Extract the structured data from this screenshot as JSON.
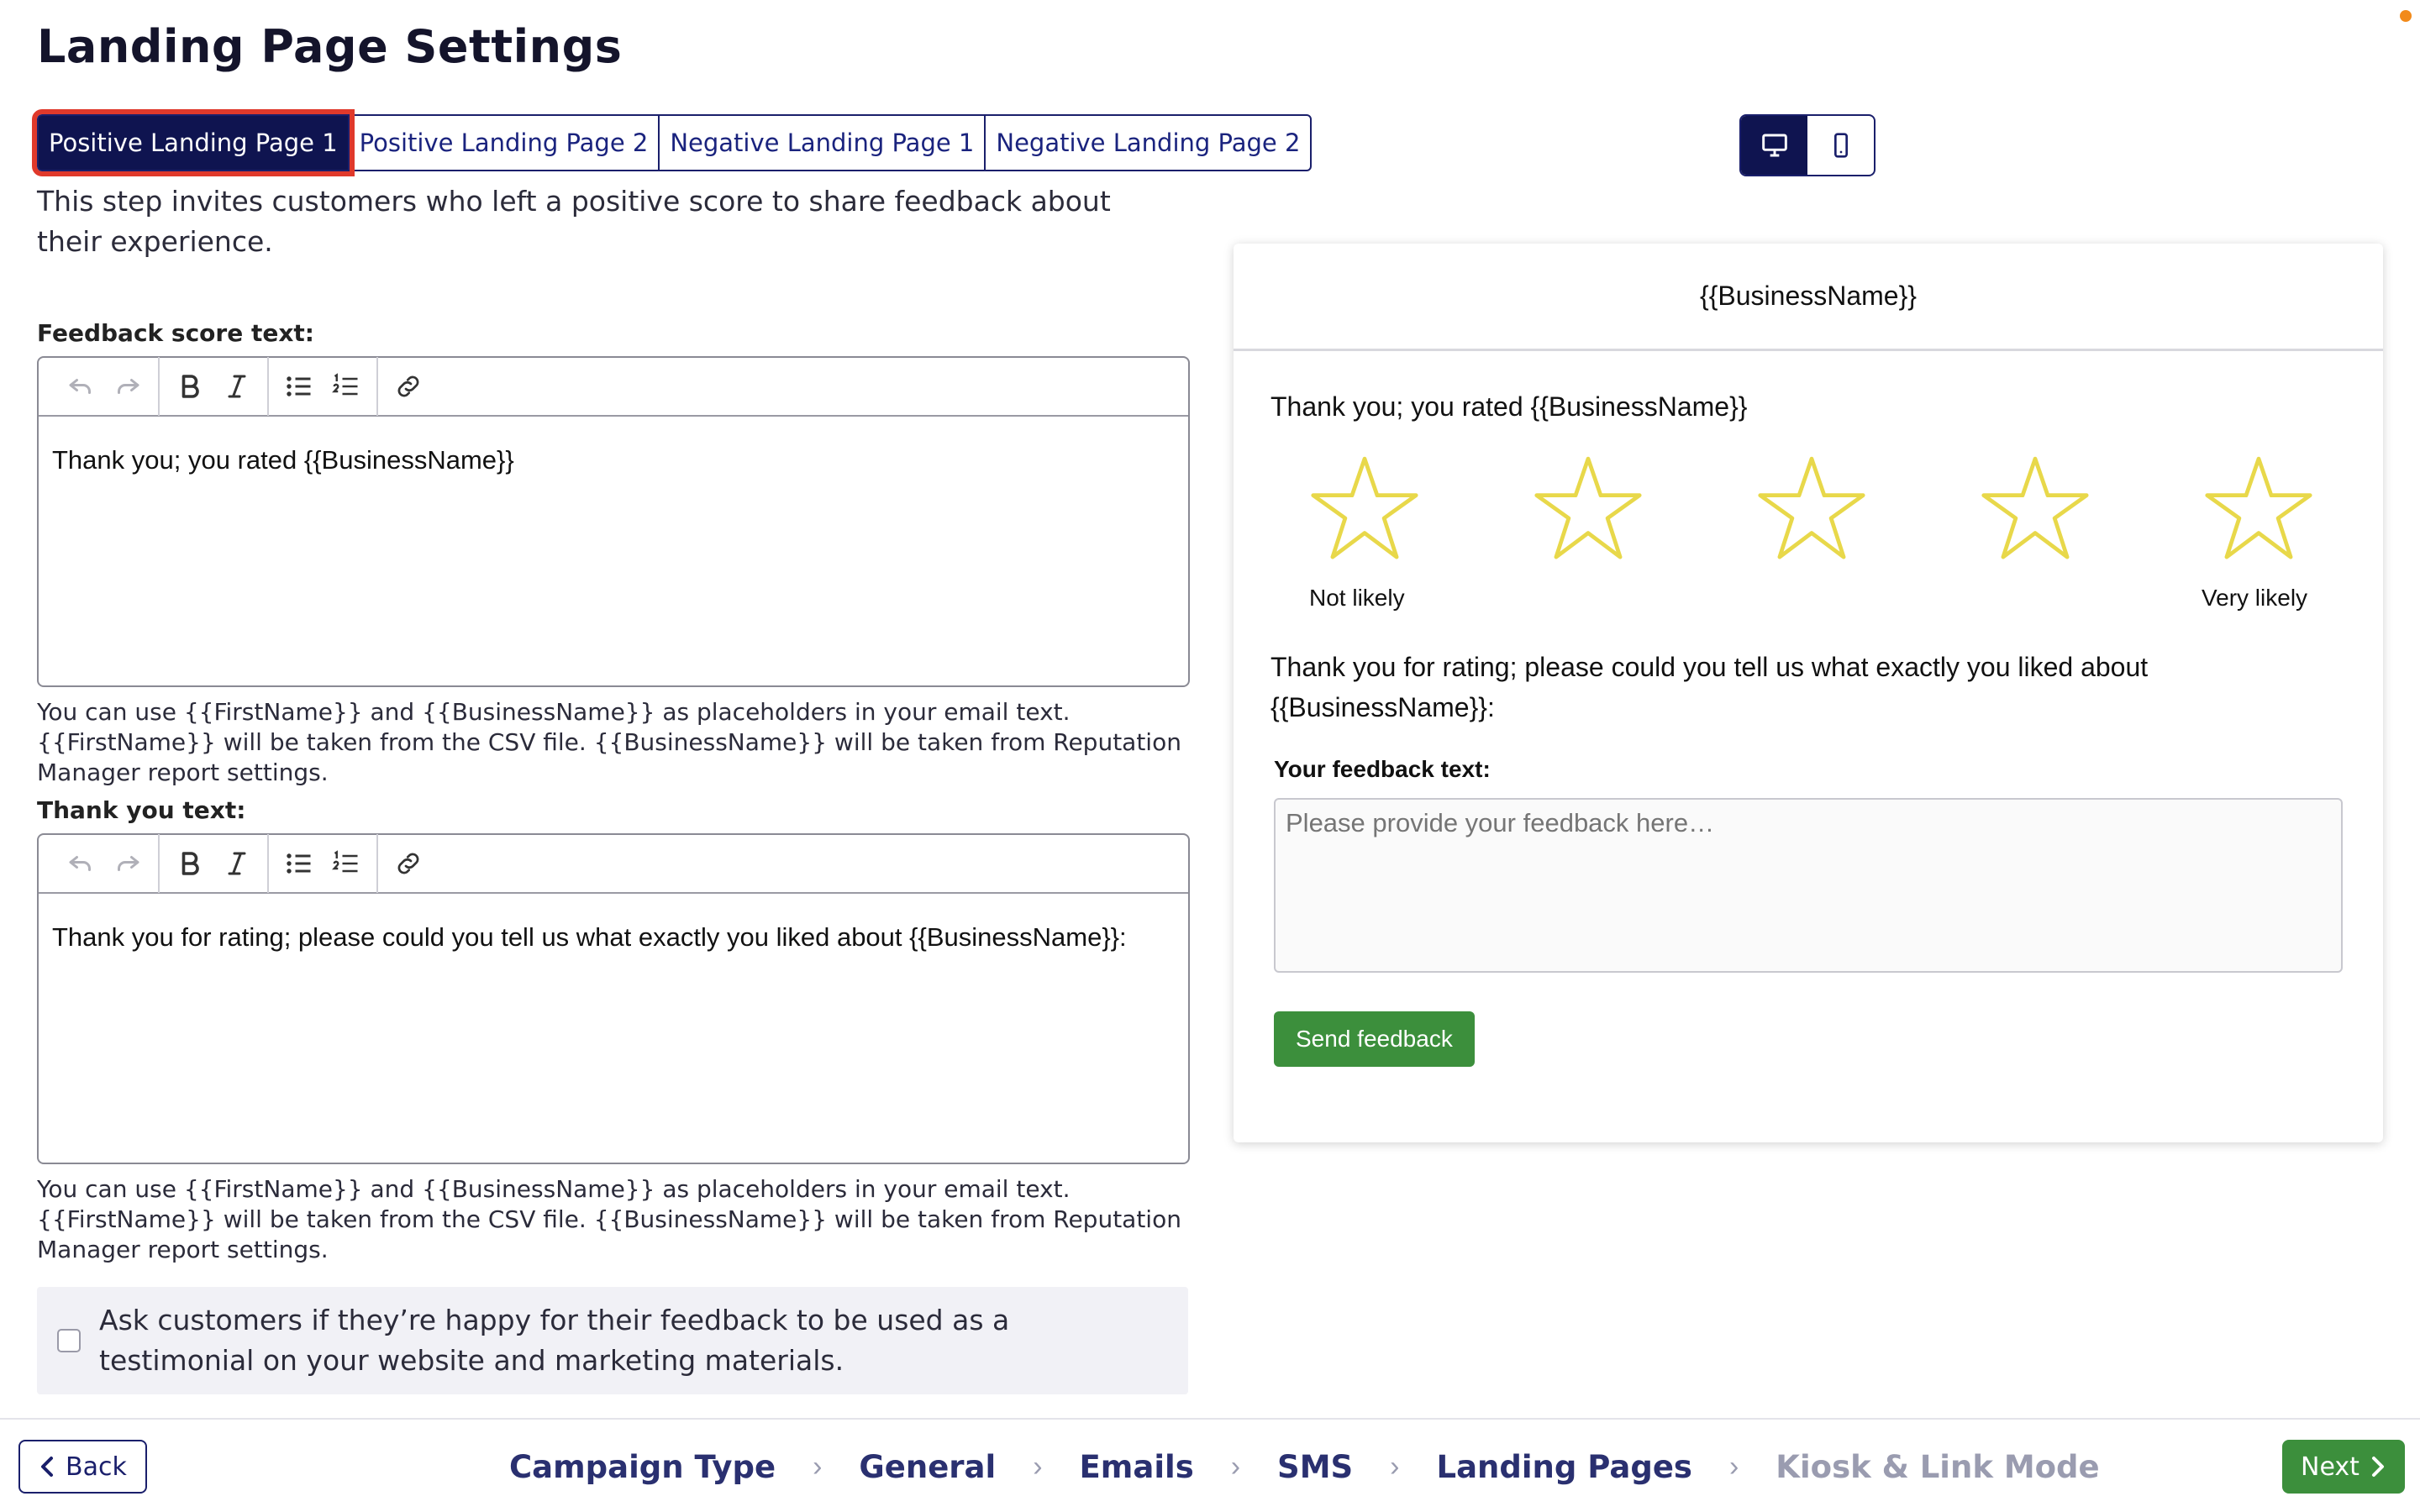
{
  "page": {
    "title": "Landing Page Settings"
  },
  "tabs": [
    {
      "label": "Positive Landing Page 1",
      "active": true
    },
    {
      "label": "Positive Landing Page 2",
      "active": false
    },
    {
      "label": "Negative Landing Page 1",
      "active": false
    },
    {
      "label": "Negative Landing Page 2",
      "active": false
    }
  ],
  "intro": "This step invites customers who left a positive score to share feedback about their experience.",
  "feedback_score": {
    "label": "Feedback score text:",
    "content": "Thank you; you rated {{BusinessName}}",
    "hint": "You can use {{FirstName}} and {{BusinessName}} as placeholders in your email text. {{FirstName}} will be taken from the CSV file. {{BusinessName}} will be taken from Reputation Manager report settings."
  },
  "thank_you": {
    "label": "Thank you text:",
    "content": "Thank you for rating; please could you tell us what exactly you liked about {{BusinessName}}:",
    "hint": "You can use {{FirstName}} and {{BusinessName}} as placeholders in your email text. {{FirstName}} will be taken from the CSV file. {{BusinessName}} will be taken from Reputation Manager report settings."
  },
  "toolbar_icons": [
    "undo-icon",
    "redo-icon",
    "bold-icon",
    "italic-icon",
    "bullet-list-icon",
    "numbered-list-icon",
    "link-icon"
  ],
  "testimonial": {
    "label": "Ask customers if they’re happy for their feedback to be used as a testimonial on your website and marketing materials.",
    "checked": false
  },
  "device_toggle": {
    "selected": "desktop"
  },
  "preview": {
    "business_name": "{{BusinessName}}",
    "score_text": "Thank you; you rated {{BusinessName}}",
    "star_count": 5,
    "star_color": "#e8d84a",
    "low_label": "Not likely",
    "high_label": "Very likely",
    "thanks_text": "Thank you for rating; please could you tell us what exactly you liked about {{BusinessName}}:",
    "feedback_label": "Your feedback text:",
    "feedback_placeholder": "Please provide your feedback here…",
    "send_label": "Send feedback"
  },
  "footer": {
    "back_label": "Back",
    "next_label": "Next",
    "steps": [
      {
        "label": "Campaign Type",
        "state": "done"
      },
      {
        "label": "General",
        "state": "done"
      },
      {
        "label": "Emails",
        "state": "done"
      },
      {
        "label": "SMS",
        "state": "done"
      },
      {
        "label": "Landing Pages",
        "state": "current"
      },
      {
        "label": "Kiosk & Link Mode",
        "state": "upcoming"
      }
    ]
  },
  "colors": {
    "primary_navy": "#0f1450",
    "active_outline": "#e0392b",
    "green": "#3c8f3c",
    "notification_dot": "#f28a1a"
  }
}
